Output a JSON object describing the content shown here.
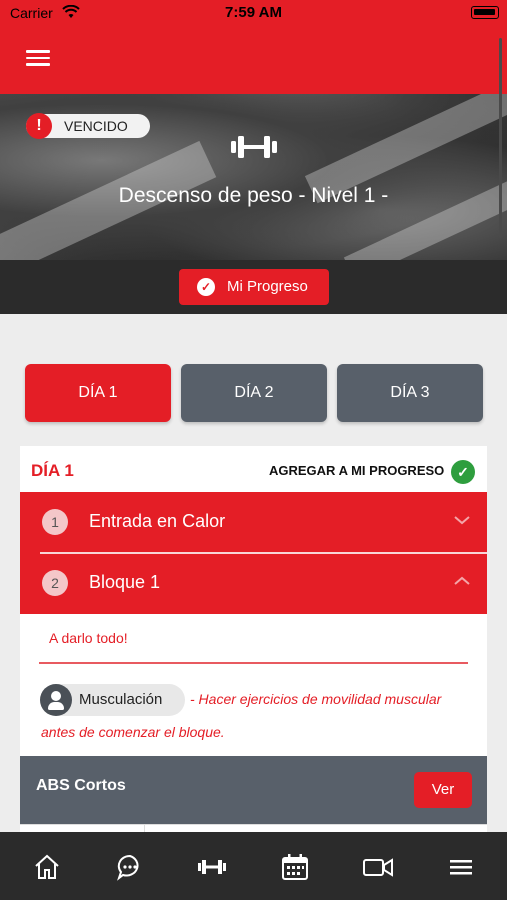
{
  "status_bar": {
    "carrier": "Carrier",
    "time": "7:59 AM"
  },
  "hero": {
    "badge": "VENCIDO",
    "title": "Descenso de peso - Nivel 1 -"
  },
  "progress_button": "Mi Progreso",
  "day_tabs": [
    {
      "label": "DÍA 1",
      "active": true
    },
    {
      "label": "DÍA 2",
      "active": false
    },
    {
      "label": "DÍA 3",
      "active": false
    }
  ],
  "day_card": {
    "title": "DÍA 1",
    "add_progress": "AGREGAR A MI PROGRESO",
    "sections": [
      {
        "number": "1",
        "label": "Entrada en Calor",
        "expanded": false
      },
      {
        "number": "2",
        "label": "Bloque 1",
        "expanded": true
      }
    ],
    "motto": "A darlo todo!",
    "chip": "Musculación",
    "description_line1": "- Hacer ejercicios de movilidad muscular",
    "description_line2": "antes de comenzar el bloque.",
    "block": {
      "title": "ABS Cortos",
      "button": "Ver"
    }
  },
  "tab_bar": [
    "home-icon",
    "chat-icon",
    "dumbbell-icon",
    "calendar-icon",
    "video-icon",
    "menu-icon"
  ],
  "colors": {
    "brand_red": "#e41e26",
    "slate": "#58606a",
    "dark": "#2b2b2b",
    "success": "#2e9e3e"
  }
}
